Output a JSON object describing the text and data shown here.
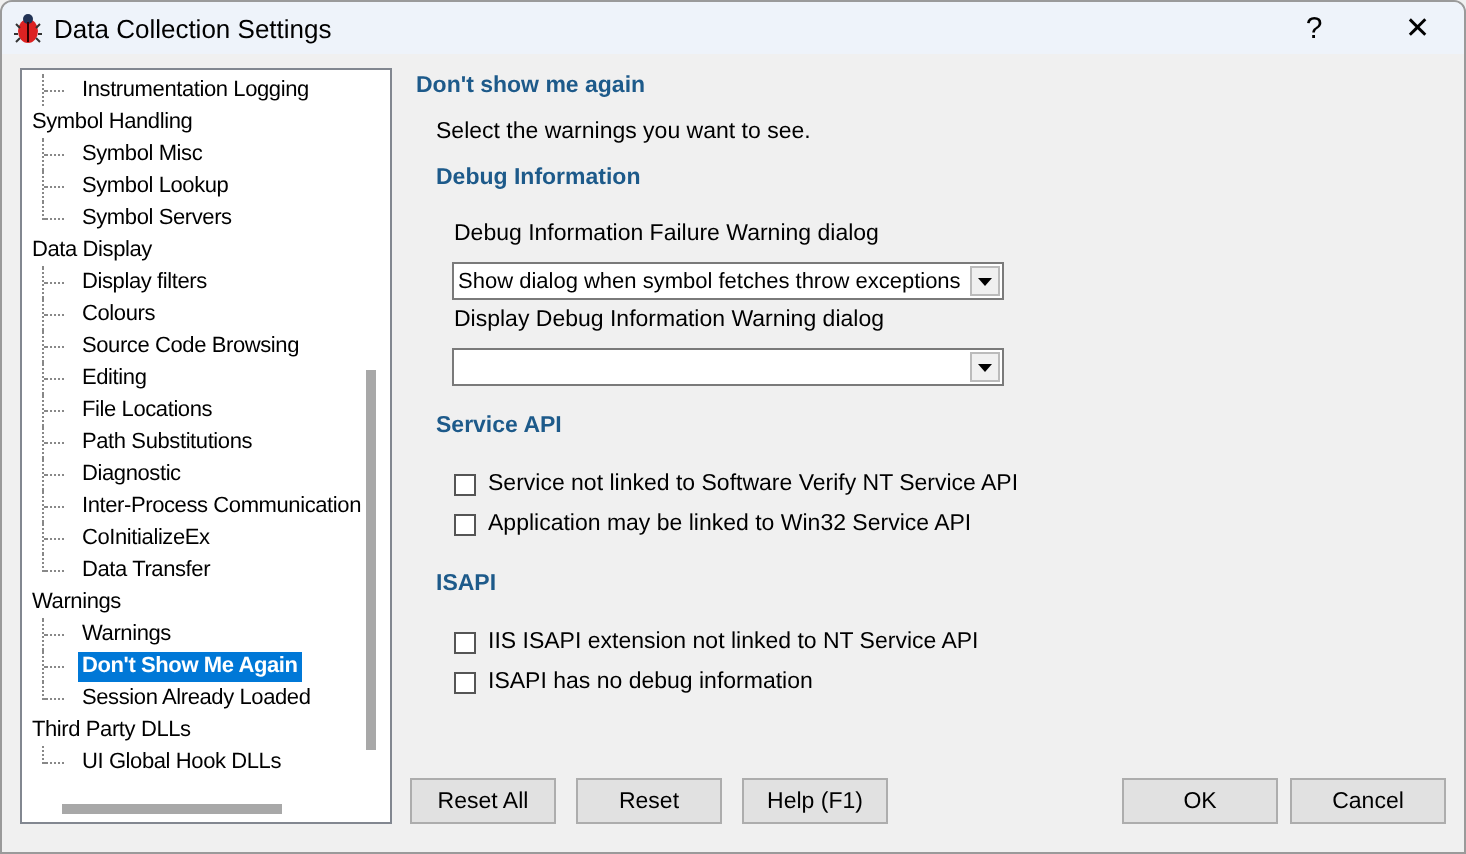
{
  "window": {
    "title": "Data Collection Settings",
    "help": "?",
    "close": "✕"
  },
  "tree": [
    {
      "kind": "leaf",
      "label": "Instrumentation Logging",
      "selected": false
    },
    {
      "kind": "group",
      "label": "Symbol Handling",
      "selected": false,
      "children": [
        {
          "label": "Symbol Misc",
          "selected": false
        },
        {
          "label": "Symbol Lookup",
          "selected": false
        },
        {
          "label": "Symbol Servers",
          "selected": false
        }
      ]
    },
    {
      "kind": "group",
      "label": "Data Display",
      "selected": false,
      "children": [
        {
          "label": "Display filters",
          "selected": false
        },
        {
          "label": "Colours",
          "selected": false
        },
        {
          "label": "Source Code Browsing",
          "selected": false
        },
        {
          "label": "Editing",
          "selected": false
        },
        {
          "label": "File Locations",
          "selected": false
        },
        {
          "label": "Path Substitutions",
          "selected": false
        },
        {
          "label": "Diagnostic",
          "selected": false
        },
        {
          "label": "Inter-Process Communication",
          "selected": false
        },
        {
          "label": "CoInitializeEx",
          "selected": false
        },
        {
          "label": "Data Transfer",
          "selected": false
        }
      ]
    },
    {
      "kind": "group",
      "label": "Warnings",
      "selected": false,
      "children": [
        {
          "label": "Warnings",
          "selected": false
        },
        {
          "label": "Don't Show Me Again",
          "selected": true
        },
        {
          "label": "Session Already Loaded",
          "selected": false
        }
      ]
    },
    {
      "kind": "group",
      "label": "Third Party DLLs",
      "selected": false,
      "children": [
        {
          "label": "UI Global Hook DLLs",
          "selected": false
        }
      ]
    }
  ],
  "page": {
    "title": "Don't show me again",
    "intro": "Select the warnings you want to see.",
    "sections": [
      {
        "kind": "dropdowns",
        "title": "Debug Information",
        "fields": [
          {
            "label": "Debug Information Failure Warning dialog",
            "value": "Show dialog when symbol fetches throw exceptions"
          },
          {
            "label": "Display Debug Information Warning dialog"
          }
        ]
      },
      {
        "kind": "checkboxes",
        "title": "Service API",
        "options": [
          {
            "label": "Service not linked to Software Verify NT Service API",
            "checked": false
          },
          {
            "label": "Application may be linked to Win32 Service API",
            "checked": false
          }
        ]
      },
      {
        "kind": "checkboxes",
        "title": "ISAPI",
        "options": [
          {
            "label": "IIS ISAPI extension not linked to NT Service API",
            "checked": false
          },
          {
            "label": "ISAPI has no debug information",
            "checked": false
          }
        ]
      }
    ]
  },
  "buttons": [
    "Reset All",
    "Reset",
    "Help (F1)"
  ],
  "dialog_buttons": [
    "OK",
    "Cancel"
  ]
}
